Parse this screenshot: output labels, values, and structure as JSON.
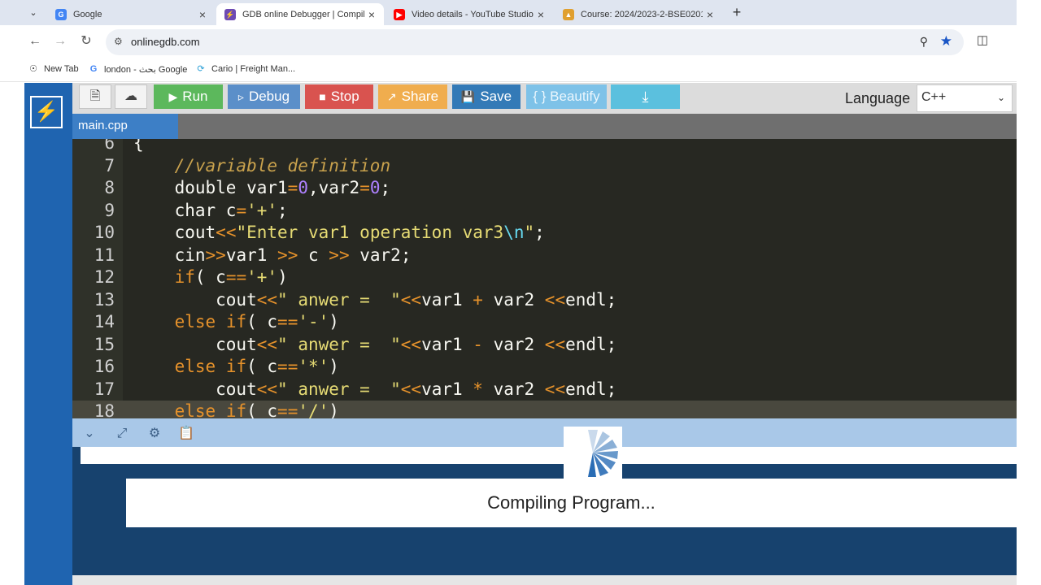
{
  "browser": {
    "tabs": [
      {
        "title": "Google",
        "favicon": "google-icon",
        "active": false
      },
      {
        "title": "GDB online Debugger | Compil",
        "favicon": "onlinegdb-icon",
        "active": true
      },
      {
        "title": "Video details - YouTube Studio",
        "favicon": "youtube-icon",
        "active": false
      },
      {
        "title": "Course: 2024/2023-2-BSE0201-",
        "favicon": "course-icon",
        "active": false
      }
    ],
    "url": "onlinegdb.com",
    "bookmarks": [
      {
        "label": "New Tab",
        "icon": "globe-icon"
      },
      {
        "label": "london - بحث Google",
        "icon": "google-icon"
      },
      {
        "label": "Cario | Freight Man...",
        "icon": "cario-icon"
      }
    ]
  },
  "app": {
    "buttons": {
      "run": "Run",
      "debug": "Debug",
      "stop": "Stop",
      "share": "Share",
      "save": "Save",
      "beautify": "{ } Beautify"
    },
    "language_label": "Language",
    "language_value": "C++",
    "file_tab": "main.cpp",
    "status": "Compiling Program...",
    "colors": {
      "sidebar": "#1f64b0",
      "run": "#5cb85c",
      "stop": "#d9534f",
      "editor_bg": "#272822"
    }
  },
  "code": [
    {
      "n": "6",
      "text": "{"
    },
    {
      "n": "7",
      "text": "    //variable definition"
    },
    {
      "n": "8",
      "text": "    double var1=0,var2=0;"
    },
    {
      "n": "9",
      "text": "    char c='+';"
    },
    {
      "n": "10",
      "text": "    cout<<\"Enter var1 operation var3\\n\";"
    },
    {
      "n": "11",
      "text": "    cin>>var1 >> c >> var2;"
    },
    {
      "n": "12",
      "text": "    if( c=='+')"
    },
    {
      "n": "13",
      "text": "        cout<<\" anwer =  \"<<var1 + var2 <<endl;"
    },
    {
      "n": "14",
      "text": "    else if( c=='-')"
    },
    {
      "n": "15",
      "text": "        cout<<\" anwer =  \"<<var1 - var2 <<endl;"
    },
    {
      "n": "16",
      "text": "    else if( c=='*')"
    },
    {
      "n": "17",
      "text": "        cout<<\" anwer =  \"<<var1 * var2 <<endl;"
    },
    {
      "n": "18",
      "text": "    else if( c=='/')"
    }
  ]
}
